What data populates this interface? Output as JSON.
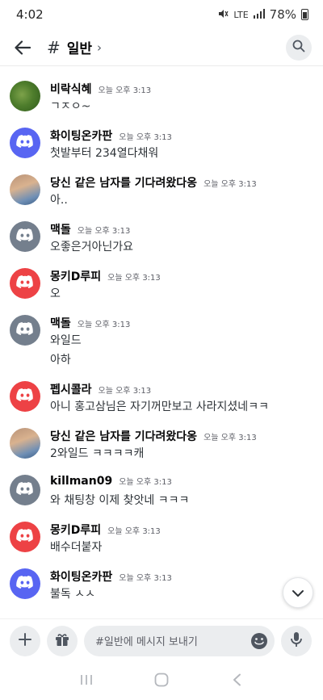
{
  "status_bar": {
    "time": "4:02",
    "network_label": "LTE",
    "battery": "78%"
  },
  "header": {
    "channel_hash": "#",
    "channel_name": "일반",
    "chevron": "›"
  },
  "messages": [
    {
      "username": "비락식혜",
      "timestamp": "오늘 오후 3:13",
      "avatar": "photo-green",
      "lines": [
        "ㄱㅈㅇ~"
      ]
    },
    {
      "username": "화이팅온카판",
      "timestamp": "오늘 오후 3:13",
      "avatar": "discord-blue",
      "lines": [
        "첫발부터 234열다채워"
      ]
    },
    {
      "username": "당신 같은 남자를 기다려왔다옹",
      "timestamp": "오늘 오후 3:13",
      "avatar": "photo-person",
      "lines": [
        "아.."
      ]
    },
    {
      "username": "맥돌",
      "timestamp": "오늘 오후 3:13",
      "avatar": "discord-gray",
      "lines": [
        "오좋은거아닌가요"
      ]
    },
    {
      "username": "몽키D루피",
      "timestamp": "오늘 오후 3:13",
      "avatar": "discord-red",
      "lines": [
        "오"
      ]
    },
    {
      "username": "맥돌",
      "timestamp": "오늘 오후 3:13",
      "avatar": "discord-gray",
      "lines": [
        "와일드",
        "아하"
      ]
    },
    {
      "username": "펩시콜라",
      "timestamp": "오늘 오후 3:13",
      "avatar": "discord-red",
      "lines": [
        "아니 홍고삼님은 자기꺼만보고 사라지셨네ㅋㅋ"
      ]
    },
    {
      "username": "당신 같은 남자를 기다려왔다옹",
      "timestamp": "오늘 오후 3:13",
      "avatar": "photo-person",
      "lines": [
        "2와일드 ㅋㅋㅋㅋ캐"
      ]
    },
    {
      "username": "killman09",
      "timestamp": "오늘 오후 3:13",
      "avatar": "discord-gray",
      "lines": [
        "와 채팅창 이제 찾앗네 ㅋㅋㅋ"
      ]
    },
    {
      "username": "몽키D루피",
      "timestamp": "오늘 오후 3:13",
      "avatar": "discord-red",
      "lines": [
        "배수더붙자"
      ]
    },
    {
      "username": "화이팅온카판",
      "timestamp": "오늘 오후 3:13",
      "avatar": "discord-blue",
      "lines": [
        "불독 ㅅㅅ"
      ]
    }
  ],
  "composer": {
    "placeholder": "#일반에 메시지 보내기"
  },
  "icons": {
    "back": "arrow-left-icon",
    "search": "search-icon",
    "add": "plus-icon",
    "gift": "gift-icon",
    "emoji": "emoji-icon",
    "mic": "microphone-icon",
    "scroll": "chevron-down-icon"
  },
  "colors": {
    "discord_blue": "#5865f2",
    "discord_gray": "#747f8d",
    "discord_red": "#ed4245"
  }
}
